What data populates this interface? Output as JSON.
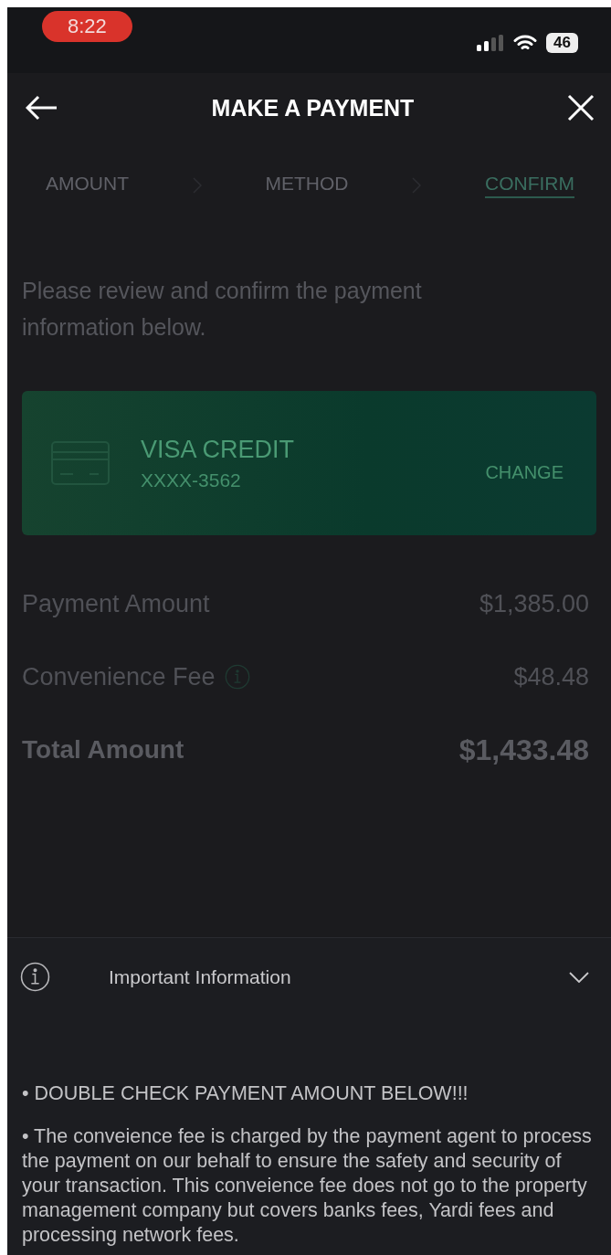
{
  "status_bar": {
    "time": "8:22",
    "battery": "46"
  },
  "header": {
    "title": "MAKE A PAYMENT"
  },
  "steps": [
    {
      "label": "AMOUNT",
      "selected": false
    },
    {
      "label": "METHOD",
      "selected": false
    },
    {
      "label": "CONFIRM",
      "selected": true
    }
  ],
  "instructions": "Please review and confirm the payment information below.",
  "payment_method": {
    "name": "VISA CREDIT",
    "number": "XXXX-3562",
    "action": "CHANGE"
  },
  "summary": [
    {
      "label": "Payment Amount",
      "value": "$1,385.00",
      "kind": "plain",
      "info": false
    },
    {
      "label": "Convenience Fee",
      "value": "$48.48",
      "kind": "plain",
      "info": true
    },
    {
      "label": "Total Amount",
      "value": "$1,433.48",
      "kind": "total",
      "info": false
    }
  ],
  "sheet": {
    "title": "Important Information",
    "expanded": true,
    "notes": [
      "• DOUBLE CHECK PAYMENT AMOUNT BELOW!!!",
      "• The conveience fee is charged by the payment agent to process the payment on our behalf to ensure the safety and security of your transaction. This conveience fee does not go to the property management company but covers banks fees, Yardi fees and processing network fees."
    ]
  }
}
